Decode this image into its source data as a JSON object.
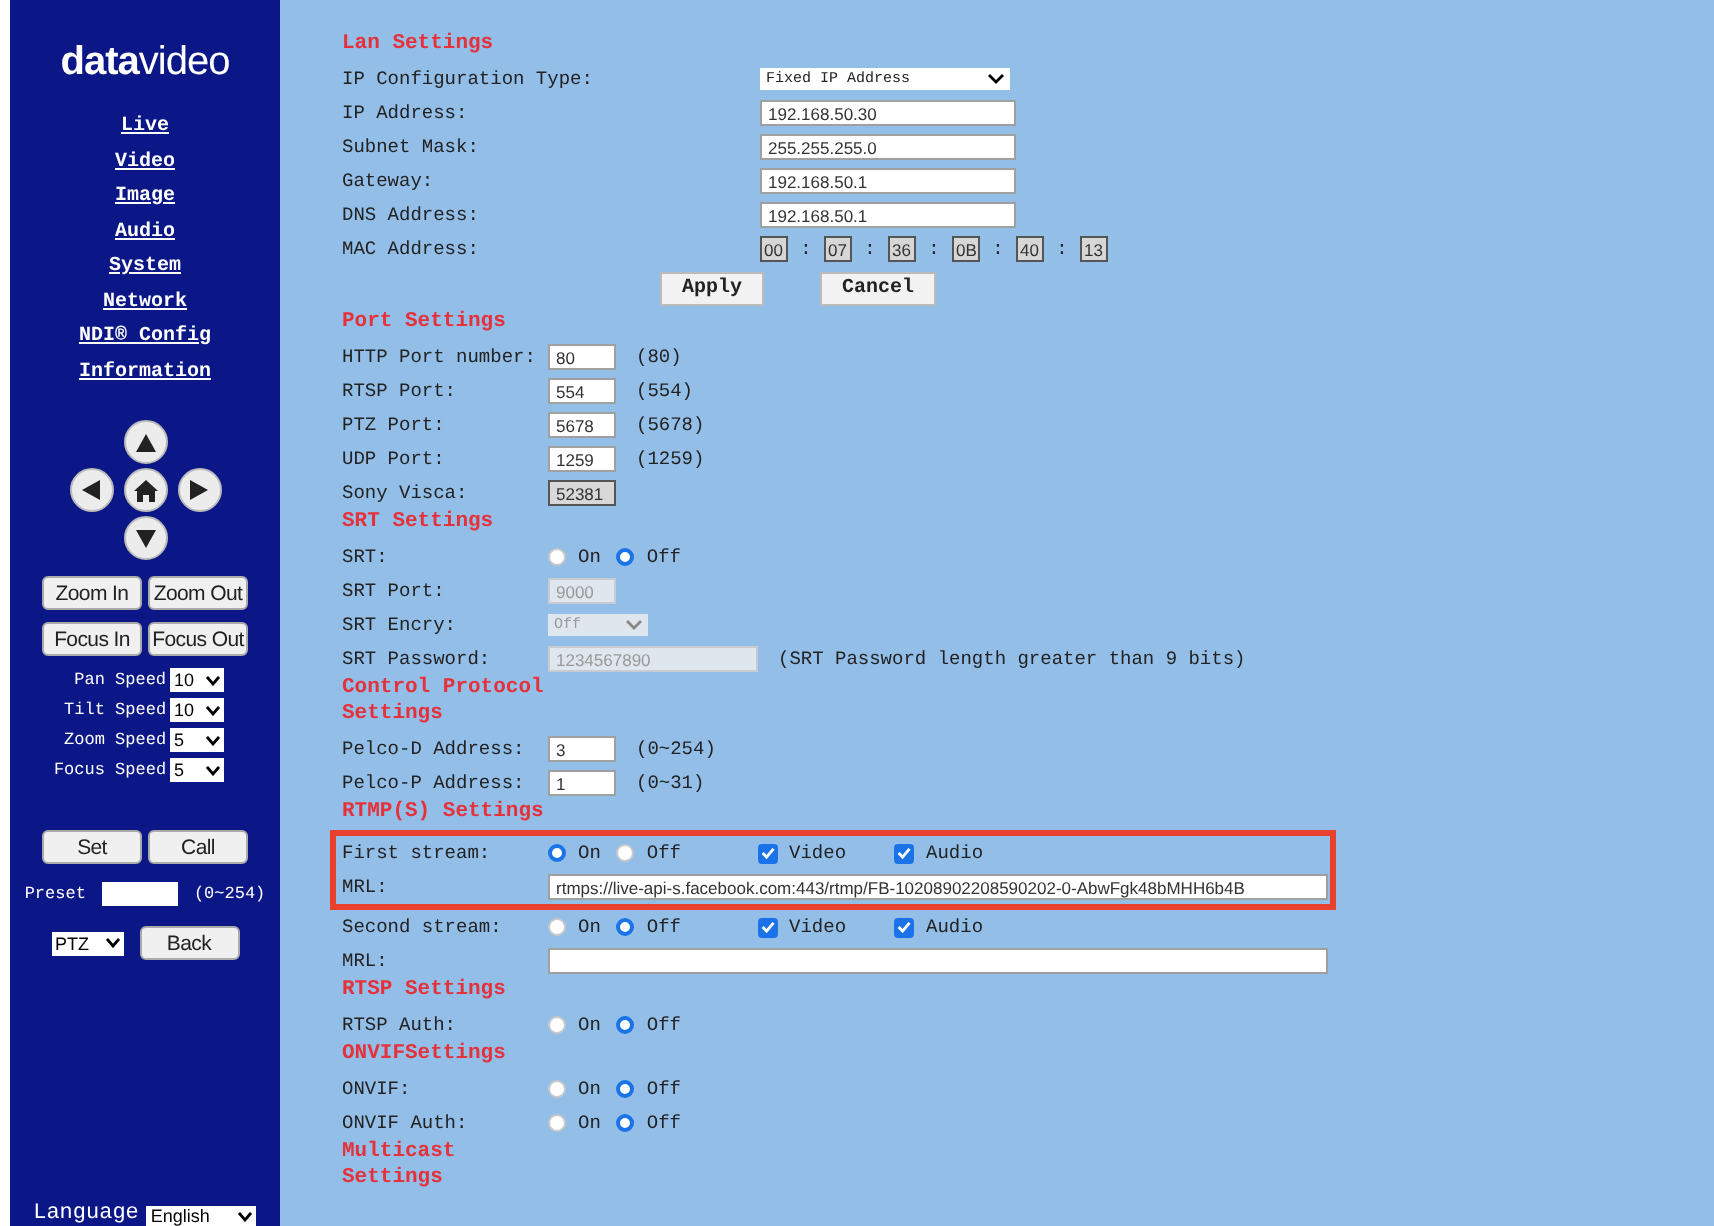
{
  "sidebar": {
    "logo": "**data**video",
    "nav": [
      "Live",
      "Video",
      "Image",
      "Audio",
      "System",
      "Network",
      "NDI® Config",
      "Information"
    ],
    "lens_buttons": [
      "Zoom In",
      "Zoom Out",
      "Focus In",
      "Focus Out"
    ],
    "speeds": [
      {
        "label": "Pan Speed",
        "value": "10"
      },
      {
        "label": "Tilt Speed",
        "value": "10"
      },
      {
        "label": "Zoom Speed",
        "value": "5"
      },
      {
        "label": "Focus Speed",
        "value": "5"
      }
    ],
    "preset_buttons": [
      "Set",
      "Call"
    ],
    "preset": {
      "label": "Preset",
      "range": "(0~254)"
    },
    "mode": "PTZ",
    "back_button": "Back",
    "language": {
      "label": "Language",
      "value": "English"
    }
  },
  "sections": [
    {
      "title": "Lan Settings",
      "kind": "wide",
      "rows": [
        {
          "kind": "select",
          "label": "IP Configuration Type:",
          "value": "Fixed IP Address",
          "disabled": false
        },
        {
          "kind": "text",
          "label": "IP Address:",
          "value": "192.168.50.30",
          "disabled": false
        },
        {
          "kind": "text",
          "label": "Subnet Mask:",
          "value": "255.255.255.0",
          "disabled": false
        },
        {
          "kind": "text",
          "label": "Gateway:",
          "value": "192.168.50.1",
          "disabled": false
        },
        {
          "kind": "text",
          "label": "DNS Address:",
          "value": "192.168.50.1",
          "disabled": false
        },
        {
          "kind": "mac",
          "label": "MAC Address:",
          "values": [
            "00",
            "07",
            "36",
            "0B",
            "40",
            "13"
          ],
          "separator": ":"
        },
        {
          "kind": "buttons",
          "buttons": [
            "Apply",
            "Cancel"
          ]
        }
      ]
    },
    {
      "title": "Port Settings",
      "kind": "narrow",
      "rows": [
        {
          "kind": "number",
          "label": "HTTP Port number:",
          "value": "80",
          "hint": "(80)",
          "disabled": false
        },
        {
          "kind": "number",
          "label": "RTSP Port:",
          "value": "554",
          "hint": "(554)",
          "disabled": false
        },
        {
          "kind": "number",
          "label": "PTZ Port:",
          "value": "5678",
          "hint": "(5678)",
          "disabled": false
        },
        {
          "kind": "number",
          "label": "UDP Port:",
          "value": "1259",
          "hint": "(1259)",
          "disabled": false
        },
        {
          "kind": "number",
          "label": "Sony Visca:",
          "value": "52381",
          "disabled": true
        }
      ]
    },
    {
      "title": "SRT Settings",
      "kind": "narrow",
      "rows": [
        {
          "kind": "radio",
          "label": "SRT:",
          "options": [
            {
              "label": "On",
              "selected": false
            },
            {
              "label": "Off",
              "selected": true
            }
          ]
        },
        {
          "kind": "number",
          "label": "SRT Port:",
          "value": "9000",
          "disabled": true
        },
        {
          "kind": "select",
          "label": "SRT Encry:",
          "value": "Off",
          "disabled": true
        },
        {
          "kind": "long_text",
          "label": "SRT Password:",
          "value": "1234567890",
          "hint": "(SRT Password length greater than 9 bits)",
          "disabled": true
        }
      ]
    },
    {
      "title": "Control Protocol Settings",
      "kind": "narrow",
      "rows": [
        {
          "kind": "number",
          "label": "Pelco-D Address:",
          "value": "3",
          "hint": "(0~254)",
          "disabled": false
        },
        {
          "kind": "number",
          "label": "Pelco-P Address:",
          "value": "1",
          "hint": "(0~31)",
          "disabled": false
        }
      ]
    },
    {
      "title": "RTMP(S) Settings",
      "kind": "narrow",
      "rows": [
        {
          "kind": "stream",
          "label": "First stream:",
          "highlighted": true,
          "options": [
            {
              "label": "On",
              "selected": true
            },
            {
              "label": "Off",
              "selected": false
            }
          ],
          "checks": [
            {
              "label": "Video",
              "checked": true
            },
            {
              "label": "Audio",
              "checked": true
            }
          ]
        },
        {
          "kind": "url",
          "label": "MRL:",
          "highlighted": true,
          "value": "rtmps://live-api-s.facebook.com:443/rtmp/FB-10208902208590202-0-AbwFgk48bMHH6b4B",
          "disabled": false
        },
        {
          "kind": "stream",
          "label": "Second stream:",
          "highlighted": false,
          "options": [
            {
              "label": "On",
              "selected": false
            },
            {
              "label": "Off",
              "selected": true
            }
          ],
          "checks": [
            {
              "label": "Video",
              "checked": true
            },
            {
              "label": "Audio",
              "checked": true
            }
          ]
        },
        {
          "kind": "url",
          "label": "MRL:",
          "highlighted": false,
          "disabled": false
        }
      ]
    },
    {
      "title": "RTSP Settings",
      "kind": "narrow",
      "rows": [
        {
          "kind": "radio",
          "label": "RTSP Auth:",
          "options": [
            {
              "label": "On",
              "selected": false
            },
            {
              "label": "Off",
              "selected": true
            }
          ]
        }
      ]
    },
    {
      "title": "ONVIFSettings",
      "kind": "narrow",
      "rows": [
        {
          "kind": "radio",
          "label": "ONVIF:",
          "options": [
            {
              "label": "On",
              "selected": false
            },
            {
              "label": "Off",
              "selected": true
            }
          ]
        },
        {
          "kind": "radio",
          "label": "ONVIF Auth:",
          "options": [
            {
              "label": "On",
              "selected": false
            },
            {
              "label": "Off",
              "selected": true
            }
          ]
        }
      ]
    },
    {
      "title": "Multicast Settings",
      "kind": "narrow"
    }
  ]
}
